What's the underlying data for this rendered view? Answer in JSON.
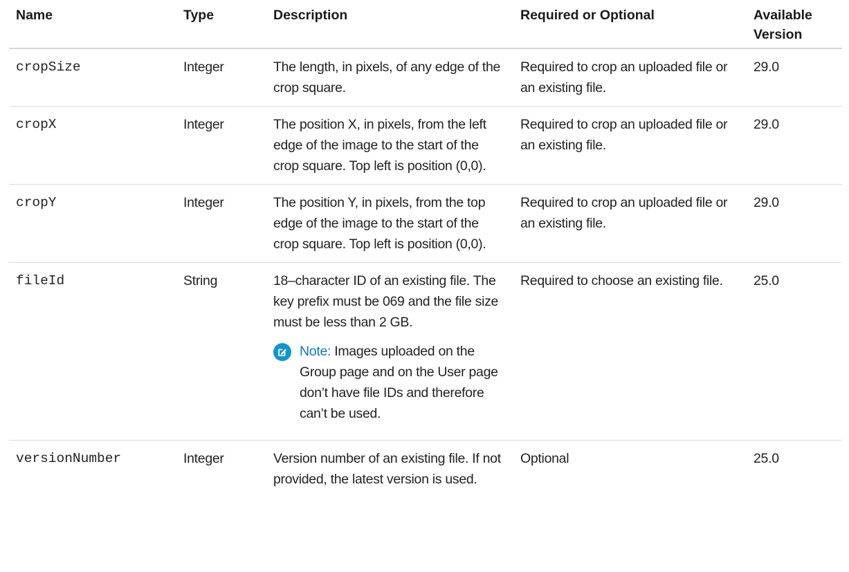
{
  "table": {
    "headers": {
      "name": "Name",
      "type": "Type",
      "description": "Description",
      "required": "Required or Optional",
      "version": "Available Version"
    },
    "rows": [
      {
        "name": "cropSize",
        "type": "Integer",
        "description": "The length, in pixels, of any edge of the crop square.",
        "required": "Required to crop an uploaded file or an existing file.",
        "version": "29.0"
      },
      {
        "name": "cropX",
        "type": "Integer",
        "description": "The position X, in pixels, from the left edge of the image to the start of the crop square. Top left is position (0,0).",
        "required": "Required to crop an uploaded file or an existing file.",
        "version": "29.0"
      },
      {
        "name": "cropY",
        "type": "Integer",
        "description": "The position Y, in pixels, from the top edge of the image to the start of the crop square. Top left is position (0,0).",
        "required": "Required to crop an uploaded file or an existing file.",
        "version": "29.0"
      },
      {
        "name": "fileId",
        "type": "String",
        "description": "18–character ID of an existing file. The key prefix must be 069 and the file size must be less than 2 GB.",
        "note_label": "Note:",
        "note_text": "Images uploaded on the Group page and on the User page don’t have file IDs and therefore can’t be used.",
        "note_icon": "edit-note-icon",
        "required": "Required to choose an existing file.",
        "version": "25.0"
      },
      {
        "name": "versionNumber",
        "type": "Integer",
        "description": "Version number of an existing file. If not provided, the latest version is used.",
        "required": "Optional",
        "version": "25.0"
      }
    ]
  },
  "colors": {
    "note_icon_bg": "#0d95d6",
    "note_label": "#0b79bd",
    "rule": "#dcdcdc"
  }
}
